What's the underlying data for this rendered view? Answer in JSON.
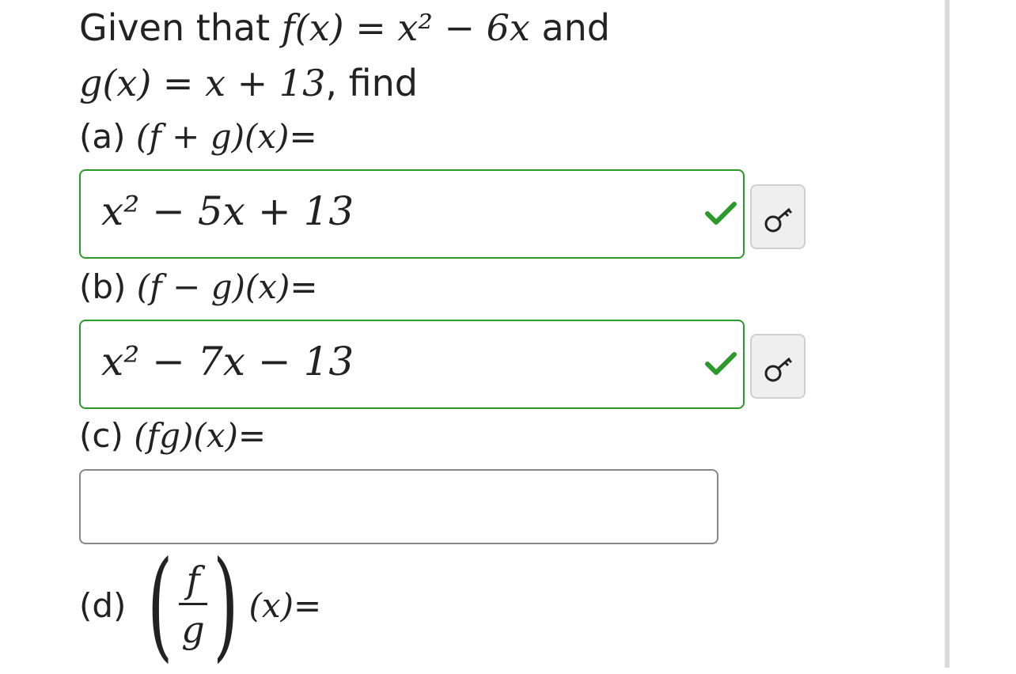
{
  "problem": {
    "given": "Given that",
    "and": "and",
    "find": ", find",
    "f_lhs": "f(x)",
    "f_rhs": "= x² − 6x",
    "g_expr": "g(x) = x + 13"
  },
  "parts": [
    {
      "label": "(a)",
      "expr": "(f + g)(x)",
      "suffix": "=",
      "answer": "x² − 5x + 13",
      "status": "correct"
    },
    {
      "label": "(b)",
      "expr": "(f − g)(x)",
      "suffix": "=",
      "answer": "x² − 7x − 13",
      "status": "correct"
    },
    {
      "label": "(c)",
      "expr": "(fg)(x)",
      "suffix": "=",
      "answer": "",
      "status": "empty"
    },
    {
      "label": "(d)",
      "frac_num": "f",
      "frac_den": "g",
      "expr_tail": "(x)",
      "suffix": "="
    }
  ],
  "icons": {
    "check": "check-icon",
    "key": "key-icon"
  },
  "colors": {
    "correct": "#2b9a2b",
    "text": "#222222",
    "button_bg": "#efefef"
  }
}
